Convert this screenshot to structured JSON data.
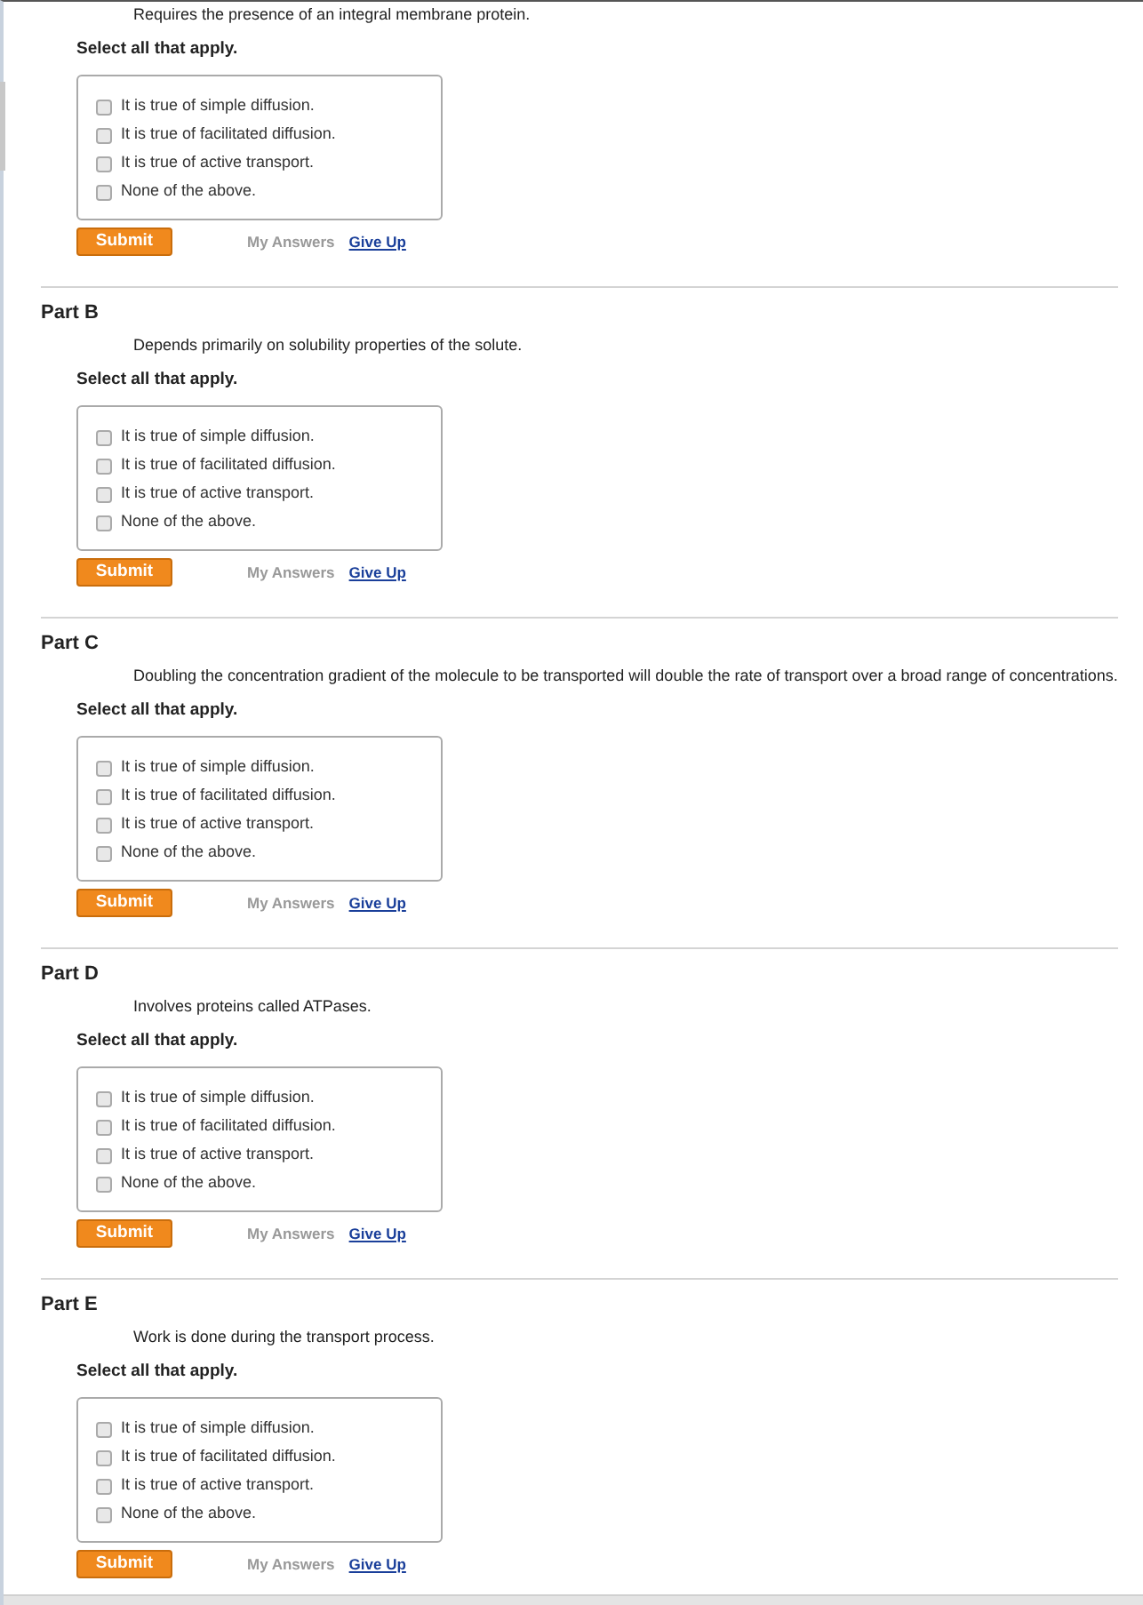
{
  "parts": [
    {
      "prompt": "Requires the presence of an integral membrane protein.",
      "instruction": "Select all that apply.",
      "options": [
        {
          "label": "It is true of simple diffusion.",
          "checked": false
        },
        {
          "label": "It is true of facilitated diffusion.",
          "checked": false
        },
        {
          "label": "It is true of active transport.",
          "checked": false
        },
        {
          "label": "None of the above.",
          "checked": false
        }
      ],
      "submit": "Submit",
      "my_answers": "My Answers",
      "give_up": "Give Up"
    },
    {
      "title": "Part B",
      "prompt": "Depends primarily on solubility properties of the solute.",
      "instruction": "Select all that apply.",
      "options": [
        {
          "label": "It is true of simple diffusion.",
          "checked": false
        },
        {
          "label": "It is true of facilitated diffusion.",
          "checked": false
        },
        {
          "label": "It is true of active transport.",
          "checked": false
        },
        {
          "label": "None of the above.",
          "checked": false
        }
      ],
      "submit": "Submit",
      "my_answers": "My Answers",
      "give_up": "Give Up"
    },
    {
      "title": "Part C",
      "prompt": "Doubling the concentration gradient of the molecule to be transported will double the rate of transport over a broad range of concentrations.",
      "instruction": "Select all that apply.",
      "options": [
        {
          "label": "It is true of simple diffusion.",
          "checked": false
        },
        {
          "label": "It is true of facilitated diffusion.",
          "checked": false
        },
        {
          "label": "It is true of active transport.",
          "checked": false
        },
        {
          "label": "None of the above.",
          "checked": false
        }
      ],
      "submit": "Submit",
      "my_answers": "My Answers",
      "give_up": "Give Up"
    },
    {
      "title": "Part D",
      "prompt": "Involves proteins called ATPases.",
      "instruction": "Select all that apply.",
      "options": [
        {
          "label": "It is true of simple diffusion.",
          "checked": false
        },
        {
          "label": "It is true of facilitated diffusion.",
          "checked": false
        },
        {
          "label": "It is true of active transport.",
          "checked": false
        },
        {
          "label": "None of the above.",
          "checked": false
        }
      ],
      "submit": "Submit",
      "my_answers": "My Answers",
      "give_up": "Give Up"
    },
    {
      "title": "Part E",
      "prompt": "Work is done during the transport process.",
      "instruction": "Select all that apply.",
      "options": [
        {
          "label": "It is true of simple diffusion.",
          "checked": false
        },
        {
          "label": "It is true of facilitated diffusion.",
          "checked": false
        },
        {
          "label": "It is true of active transport.",
          "checked": false
        },
        {
          "label": "None of the above.",
          "checked": false
        }
      ],
      "submit": "Submit",
      "my_answers": "My Answers",
      "give_up": "Give Up"
    }
  ]
}
